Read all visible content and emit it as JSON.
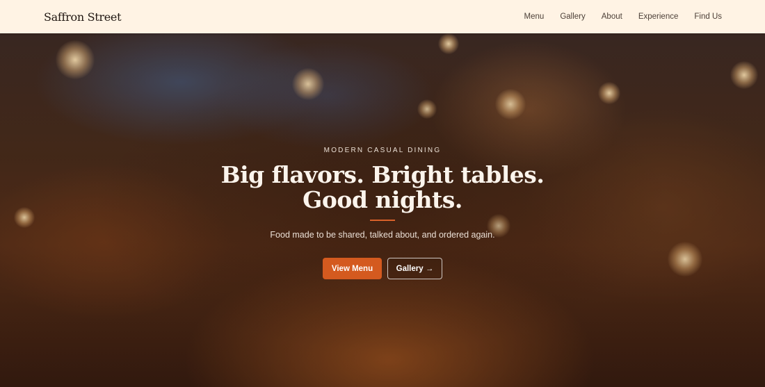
{
  "header": {
    "brand": "Saffron Street",
    "nav": [
      {
        "label": "Menu"
      },
      {
        "label": "Gallery"
      },
      {
        "label": "About"
      },
      {
        "label": "Experience"
      },
      {
        "label": "Find Us"
      }
    ]
  },
  "hero": {
    "eyebrow": "MODERN CASUAL DINING",
    "headline_line1": "Big flavors. Bright tables.",
    "headline_line2": "Good nights.",
    "subtitle": "Food made to be shared, talked about, and ordered again.",
    "primary_button": "View Menu",
    "secondary_button": "Gallery →"
  },
  "colors": {
    "header_bg": "#fff3e4",
    "accent": "#d45a1f",
    "hero_text": "#fbf4ec"
  }
}
